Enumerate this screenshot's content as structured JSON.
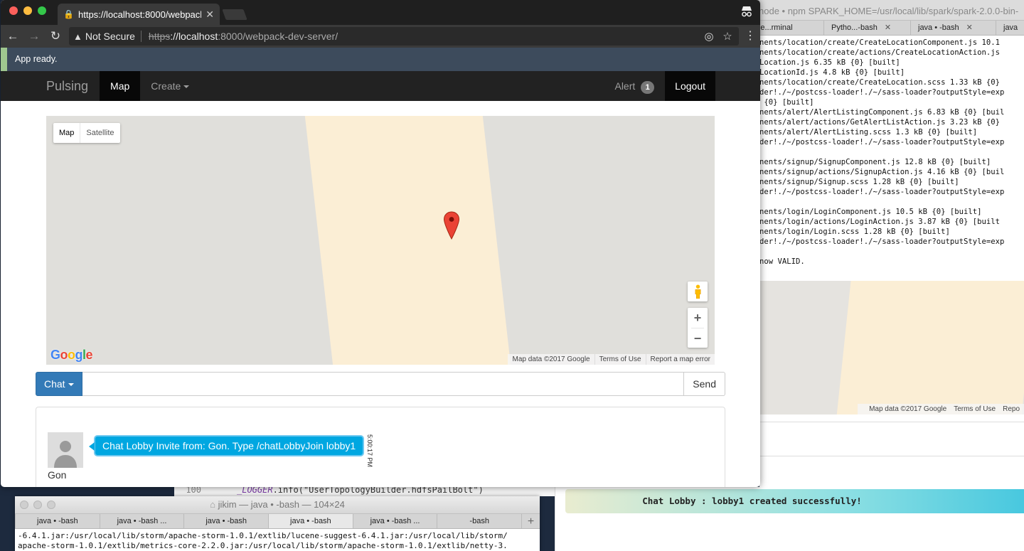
{
  "terminal_right": {
    "title": "node • npm SPARK_HOME=/usr/local/lib/spark/spark-2.0.0-bin-",
    "tabs": [
      "node...rminal",
      "Pytho...-bash",
      "java • -bash",
      "java"
    ],
    "log": "nents/location/create/CreateLocationComponent.js 10.1\nnents/location/create/actions/CreateLocationAction.js\nLocation.js 6.35 kB {0} [built]\nLocationId.js 4.8 kB {0} [built]\nnents/location/create/CreateLocation.scss 1.33 kB {0}\nder!./~/postcss-loader!./~/sass-loader?outputStyle=exp\n {0} [built]\nnents/alert/AlertListingComponent.js 6.83 kB {0} [buil\nnents/alert/actions/GetAlertListAction.js 3.23 kB {0}\nnents/alert/AlertListing.scss 1.3 kB {0} [built]\nder!./~/postcss-loader!./~/sass-loader?outputStyle=exp\n\nnents/signup/SignupComponent.js 12.8 kB {0} [built]\nnents/signup/actions/SignupAction.js 4.16 kB {0} [buil\nnents/signup/Signup.scss 1.28 kB {0} [built]\nder!./~/postcss-loader!./~/sass-loader?outputStyle=exp\n\nnents/login/LoginComponent.js 10.5 kB {0} [built]\nnents/login/actions/LoginAction.js 3.87 kB {0} [built\nnents/login/Login.scss 1.28 kB {0} [built]\nder!./~/postcss-loader!./~/sass-loader?outputStyle=exp\n\nnow VALID."
  },
  "bg_map_attr": [
    "Map data ©2017 Google",
    "Terms of Use",
    "Repo"
  ],
  "toast": "Chat Lobby : lobby1 created successfully!",
  "code_strip": {
    "line_no": "100",
    "code_obj": "_LOGGER",
    "code_rest": ".info(\"UserTopologyBuilder.hdfsPailBolt\")"
  },
  "terminal_bottom": {
    "title": "jikim — java • -bash — 104×24",
    "tabs": [
      "java • -bash",
      "java • -bash ...",
      "java • -bash",
      "java • -bash",
      "java • -bash ...",
      "-bash"
    ],
    "log": "-6.4.1.jar:/usr/local/lib/storm/apache-storm-1.0.1/extlib/lucene-suggest-6.4.1.jar:/usr/local/lib/storm/\napache-storm-1.0.1/extlib/metrics-core-2.2.0.jar:/usr/local/lib/storm/apache-storm-1.0.1/extlib/netty-3."
  },
  "browser": {
    "tab_title": "https://localhost:8000/webpack",
    "omnibox": {
      "security": "Not Secure",
      "scheme": "https",
      "host": "://localhost",
      "rest": ":8000/webpack-dev-server/"
    },
    "status": "App ready."
  },
  "navbar": {
    "brand": "Pulsing",
    "map": "Map",
    "create": "Create",
    "alert": "Alert",
    "alert_count": "1",
    "logout": "Logout"
  },
  "map": {
    "type_map": "Map",
    "type_satellite": "Satellite",
    "zoom_in": "+",
    "zoom_out": "−",
    "attribution": [
      "Map data ©2017 Google",
      "Terms of Use",
      "Report a map error"
    ]
  },
  "chat": {
    "button": "Chat",
    "input_value": "",
    "send": "Send",
    "message": {
      "user": "Gon",
      "text": "Chat Lobby Invite from: Gon. Type /chatLobbyJoin lobby1",
      "time": "5:00:17 PM"
    }
  },
  "colors": {
    "primary": "#337ab7",
    "bubble": "#00a7e1",
    "navbar": "#222222",
    "status_bar": "#3d4b5c"
  }
}
